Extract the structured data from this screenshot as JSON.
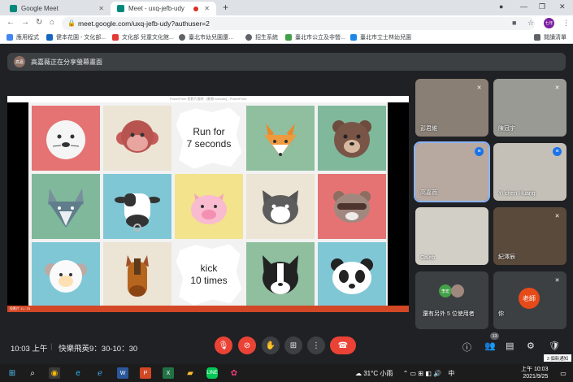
{
  "browser": {
    "tabs": [
      {
        "title": "Google Meet",
        "active": false
      },
      {
        "title": "Meet - uxq-jefb-udy",
        "active": true,
        "recording": true
      }
    ],
    "new_tab": "+",
    "address": "meet.google.com/uxq-jefb-udy?authuser=2",
    "profile_initials": "七年",
    "bookmarks": [
      {
        "label": "應用程式"
      },
      {
        "label": "健本花園 - 文化部..."
      },
      {
        "label": "文化部 兒童文化館..."
      },
      {
        "label": "臺北市幼兒園還…"
      },
      {
        "label": "招生系統"
      },
      {
        "label": "臺北市公立及非營..."
      },
      {
        "label": "臺北市立士林幼兒園"
      }
    ],
    "reading_list": "閱讀清單"
  },
  "meet": {
    "presenting_text": "高嘉薇正在分享螢幕畫面",
    "presenter_avatar": "高嘉",
    "slide": {
      "title_bar": "PowerPoint 投影片放映 - [動物 animals] - PowerPoint",
      "status_bar": "投影片 11 / 23",
      "run_text_1": "Run for",
      "run_text_2": "7 seconds",
      "kick_text_1": "kick",
      "kick_text_2": "10 times"
    },
    "participants": [
      {
        "name": "彭君維",
        "mic": "muted"
      },
      {
        "name": "陳冠宇",
        "mic": "muted"
      },
      {
        "name": "高嘉薇",
        "mic": "speaking"
      },
      {
        "name": "Yi chen Huang",
        "mic": "speaking"
      },
      {
        "name": "Caleb",
        "mic": "none"
      },
      {
        "name": "紀澤辰",
        "mic": "muted"
      }
    ],
    "others_text": "還有另外 5 位使用者",
    "others_avatar_initials": "李宏",
    "self_name": "你",
    "self_avatar": "老師",
    "clock": "10:03 上午",
    "separator": "|",
    "meeting_title": "快樂飛英9：30-10：30",
    "participant_count": "13",
    "notification": "3 個新通知"
  },
  "taskbar": {
    "weather": "31°C 小雨",
    "ime": "中",
    "time": "上午 10:03",
    "date": "2021/9/25"
  }
}
